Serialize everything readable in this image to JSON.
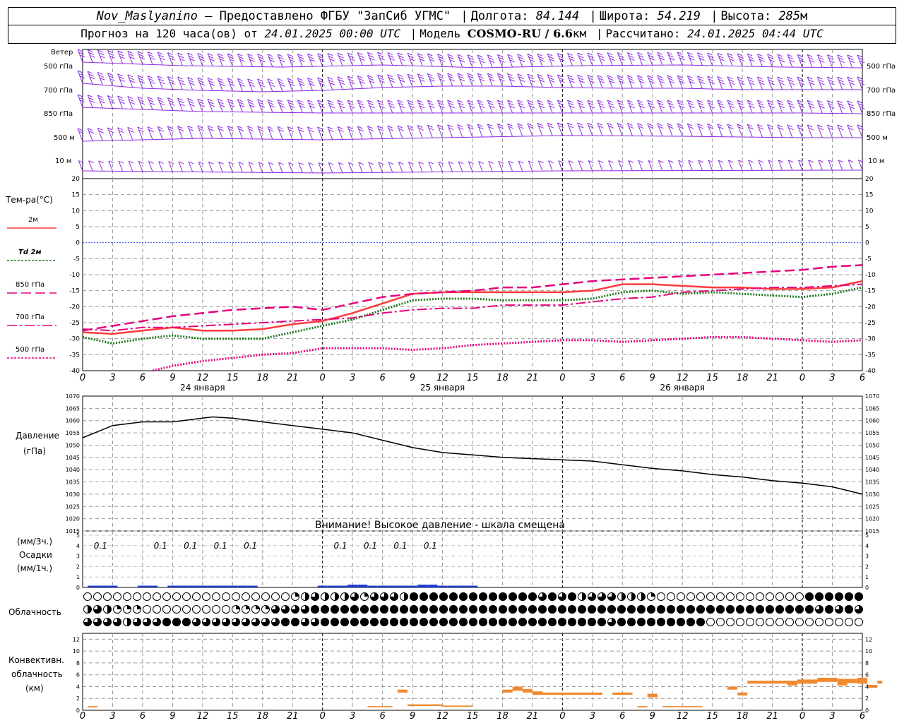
{
  "header": {
    "station": "Nov_Maslyanino",
    "provider": "— Предоставлено ФГБУ \"ЗапСиб УГМС\"",
    "lon_label": "Долгота:",
    "lon": "84.144",
    "lat_label": "Широта:",
    "lat": "54.219",
    "alt_label": "Высота:",
    "alt": "285",
    "alt_unit": "м",
    "forecast_label": "Прогноз на 120 часа(ов) от",
    "forecast_start": "24.01.2025 00:00 UTC",
    "model_label": "Модель",
    "model": "COSMO-RU / 6.6",
    "model_unit": "км",
    "calc_label": "Рассчитано:",
    "calc_time": "24.01.2025 04:44 UTC"
  },
  "wind_panel": {
    "title": "Ветер",
    "levels": [
      "500 гПа",
      "700 гПа",
      "850 гПа",
      "500 м",
      "10 м"
    ],
    "color": "#8a2be2"
  },
  "temp_panel": {
    "title": "Тем-ра(°С)",
    "legend": [
      {
        "label": "2м",
        "color": "#ff3b3b",
        "style": "solid"
      },
      {
        "label": "Td 2м",
        "color": "#1a7a1a",
        "style": "dotted"
      },
      {
        "label": "850 гПа",
        "color": "#e6007e",
        "style": "dashed"
      },
      {
        "label": "700 гПа",
        "color": "#e6007e",
        "style": "dashdot"
      },
      {
        "label": "500 гПа",
        "color": "#e6007e",
        "style": "dotted"
      }
    ],
    "yticks": [
      20,
      15,
      10,
      5,
      0,
      -5,
      -10,
      -15,
      -20,
      -25,
      -30,
      -35,
      -40
    ]
  },
  "time_axis": {
    "hour_labels": [
      "0",
      "3",
      "6",
      "9",
      "12",
      "15",
      "18",
      "21",
      "0",
      "3",
      "6",
      "9",
      "12",
      "15",
      "18",
      "21",
      "0",
      "3",
      "6",
      "9",
      "12",
      "15",
      "18",
      "21",
      "0",
      "3",
      "6"
    ],
    "days": [
      "24 января",
      "25 января",
      "26 января"
    ]
  },
  "pressure_panel": {
    "title_line1": "Давление",
    "title_line2": "(гПа)",
    "warning": "Внимание! Высокое давление - шкала смещена",
    "yticks": [
      1070,
      1065,
      1060,
      1055,
      1050,
      1045,
      1040,
      1035,
      1030,
      1025,
      1020,
      1015
    ]
  },
  "precip_panel": {
    "label_top": "(мм/3ч.)",
    "label_mid": "Осадки",
    "label_bot": "(мм/1ч.)",
    "yticks": [
      "5",
      "4",
      "3",
      "2",
      "1",
      "0"
    ],
    "amount_labels": [
      {
        "hour": 2,
        "text": "0.1"
      },
      {
        "hour": 8,
        "text": "0.1"
      },
      {
        "hour": 11,
        "text": "0.1"
      },
      {
        "hour": 14,
        "text": "0.1"
      },
      {
        "hour": 17,
        "text": "0.1"
      },
      {
        "hour": 26,
        "text": "0.1"
      },
      {
        "hour": 29,
        "text": "0.1"
      },
      {
        "hour": 32,
        "text": "0.1"
      },
      {
        "hour": 35,
        "text": "0.1"
      }
    ]
  },
  "cloud_panel": {
    "title": "Облачность"
  },
  "conv_panel": {
    "title_line1": "Конвективн.",
    "title_line2": "облачность",
    "title_line3": "(км)",
    "yticks": [
      "12",
      "10",
      "8",
      "6",
      "4",
      "2",
      "0"
    ],
    "color": "#f08a30"
  },
  "chart_data": [
    {
      "type": "line",
      "title": "Тем-ра(°С)",
      "x_unit": "hours from 24.01.2025 00:00 UTC",
      "ylim": [
        -40,
        20
      ],
      "series": [
        {
          "name": "2м",
          "x": [
            0,
            3,
            6,
            9,
            12,
            15,
            18,
            21,
            24,
            27,
            30,
            33,
            36,
            39,
            42,
            45,
            48,
            51,
            54,
            57,
            60,
            63,
            66,
            69,
            72,
            75,
            78
          ],
          "y": [
            -28,
            -28.5,
            -27.5,
            -26.5,
            -27.5,
            -27.5,
            -27,
            -25.5,
            -24.5,
            -22,
            -19,
            -16,
            -15.5,
            -15.5,
            -15.5,
            -15.5,
            -15.5,
            -15,
            -13,
            -13,
            -13.5,
            -14,
            -14,
            -14.5,
            -14.5,
            -14,
            -12
          ]
        },
        {
          "name": "Td 2м",
          "x": [
            0,
            3,
            6,
            9,
            12,
            15,
            18,
            21,
            24,
            27,
            30,
            33,
            36,
            39,
            42,
            45,
            48,
            51,
            54,
            57,
            60,
            63,
            66,
            69,
            72,
            75,
            78
          ],
          "y": [
            -29.5,
            -31.5,
            -30,
            -29,
            -30,
            -30,
            -30,
            -28,
            -26,
            -24,
            -21,
            -18,
            -17.5,
            -17.5,
            -18,
            -18,
            -18,
            -17.5,
            -15.5,
            -15,
            -16,
            -15.5,
            -16,
            -16.5,
            -17,
            -16,
            -14
          ]
        },
        {
          "name": "850 гПа",
          "x": [
            0,
            3,
            6,
            9,
            12,
            15,
            18,
            21,
            24,
            27,
            30,
            33,
            36,
            39,
            42,
            45,
            48,
            51,
            54,
            57,
            60,
            63,
            66,
            69,
            72,
            75,
            78
          ],
          "y": [
            -27.5,
            -26,
            -24.5,
            -23,
            -22,
            -21,
            -20.5,
            -20,
            -21,
            -19,
            -17,
            -16,
            -15.5,
            -15,
            -14,
            -14,
            -13,
            -12,
            -11.5,
            -11,
            -10.5,
            -10,
            -9.5,
            -9,
            -8.5,
            -7.5,
            -7
          ]
        },
        {
          "name": "700 гПа",
          "x": [
            0,
            3,
            6,
            9,
            12,
            15,
            18,
            21,
            24,
            27,
            30,
            33,
            36,
            39,
            42,
            45,
            48,
            51,
            54,
            57,
            60,
            63,
            66,
            69,
            72,
            75,
            78
          ],
          "y": [
            -27,
            -27.5,
            -26.5,
            -26.5,
            -26,
            -25.5,
            -25,
            -24.5,
            -24,
            -23.5,
            -22,
            -21,
            -20.5,
            -20.5,
            -19.5,
            -19.5,
            -19.5,
            -18.5,
            -17.5,
            -17,
            -15.5,
            -15,
            -14.5,
            -14,
            -14,
            -13.5,
            -13
          ]
        },
        {
          "name": "500 гПа",
          "x": [
            7,
            9,
            12,
            15,
            18,
            21,
            24,
            27,
            30,
            33,
            36,
            39,
            42,
            45,
            48,
            51,
            54,
            57,
            60,
            63,
            66,
            69,
            72,
            75,
            78
          ],
          "y": [
            -40,
            -38.5,
            -37,
            -36,
            -35,
            -34.5,
            -33,
            -33,
            -33,
            -33.5,
            -33,
            -32,
            -31.5,
            -31,
            -30.5,
            -30.5,
            -31,
            -30.5,
            -30,
            -29.5,
            -29.5,
            -30,
            -30.5,
            -31,
            -30.5
          ]
        }
      ]
    },
    {
      "type": "line",
      "title": "Давление",
      "x_unit": "hours from 24.01.2025 00:00 UTC",
      "ylim": [
        1015,
        1070
      ],
      "series": [
        {
          "name": "Давление",
          "x": [
            0,
            3,
            6,
            9,
            12,
            13,
            15,
            18,
            21,
            24,
            27,
            30,
            33,
            36,
            39,
            42,
            45,
            48,
            51,
            54,
            57,
            60,
            63,
            66,
            69,
            72,
            75,
            78
          ],
          "y": [
            1053,
            1058,
            1059.5,
            1059.5,
            1061,
            1061.5,
            1061,
            1059.5,
            1058,
            1056.5,
            1055,
            1052,
            1049,
            1047,
            1046,
            1045,
            1044.5,
            1044,
            1043.5,
            1042,
            1040.5,
            1039.5,
            1038,
            1037,
            1035.5,
            1034.5,
            1033,
            1030
          ]
        }
      ]
    },
    {
      "type": "bar",
      "title": "Осадки",
      "x_unit": "hours from 24.01.2025 00:00 UTC",
      "ylim": [
        0,
        5
      ],
      "x": [
        1,
        2,
        3,
        6,
        7,
        9,
        10,
        11,
        12,
        13,
        14,
        15,
        16,
        17,
        24,
        25,
        26,
        27,
        28,
        29,
        30,
        31,
        32,
        33,
        34,
        35,
        36,
        37,
        38,
        39
      ],
      "values": [
        0.1,
        0.1,
        0.1,
        0.1,
        0.1,
        0.1,
        0.1,
        0.1,
        0.1,
        0.1,
        0.1,
        0.1,
        0.1,
        0.1,
        0.1,
        0.1,
        0.1,
        0.2,
        0.2,
        0.1,
        0.1,
        0.1,
        0.1,
        0.1,
        0.2,
        0.2,
        0.1,
        0.1,
        0.1,
        0.1
      ]
    },
    {
      "type": "bar",
      "title": "Конвективн. облачность (км)",
      "x_unit": "hours from 24.01.2025 00:00 UTC",
      "ylim": [
        0,
        13
      ],
      "segments": [
        {
          "x0": 0.5,
          "x1": 1.5,
          "bottom": 0.5,
          "top": 0.7
        },
        {
          "x0": 28.5,
          "x1": 31,
          "bottom": 0.6,
          "top": 0.7
        },
        {
          "x0": 31.5,
          "x1": 32.5,
          "bottom": 3,
          "top": 3.5
        },
        {
          "x0": 32.5,
          "x1": 36,
          "bottom": 0.7,
          "top": 1
        },
        {
          "x0": 36,
          "x1": 39,
          "bottom": 0.6,
          "top": 0.8
        },
        {
          "x0": 42,
          "x1": 43,
          "bottom": 3,
          "top": 3.5
        },
        {
          "x0": 43,
          "x1": 44,
          "bottom": 3.3,
          "top": 4
        },
        {
          "x0": 44,
          "x1": 45,
          "bottom": 3,
          "top": 3.6
        },
        {
          "x0": 45,
          "x1": 46,
          "bottom": 2.6,
          "top": 3.2
        },
        {
          "x0": 46,
          "x1": 50,
          "bottom": 2.6,
          "top": 3
        },
        {
          "x0": 50,
          "x1": 51,
          "bottom": 2.6,
          "top": 3
        },
        {
          "x0": 51,
          "x1": 52,
          "bottom": 2.6,
          "top": 3
        },
        {
          "x0": 53,
          "x1": 55,
          "bottom": 2.6,
          "top": 3
        },
        {
          "x0": 55.5,
          "x1": 56.5,
          "bottom": 0.5,
          "top": 0.7
        },
        {
          "x0": 56.5,
          "x1": 57.5,
          "bottom": 2.2,
          "top": 2.8
        },
        {
          "x0": 58,
          "x1": 62,
          "bottom": 0.6,
          "top": 0.7
        },
        {
          "x0": 64.5,
          "x1": 65.5,
          "bottom": 3.5,
          "top": 4
        },
        {
          "x0": 65.5,
          "x1": 66.5,
          "bottom": 2.5,
          "top": 3
        },
        {
          "x0": 66.5,
          "x1": 70.5,
          "bottom": 4.5,
          "top": 5
        },
        {
          "x0": 70.5,
          "x1": 71.5,
          "bottom": 4.2,
          "top": 5
        },
        {
          "x0": 71.5,
          "x1": 73.5,
          "bottom": 4.5,
          "top": 5.2
        },
        {
          "x0": 73.5,
          "x1": 75.5,
          "bottom": 4.8,
          "top": 5.5
        },
        {
          "x0": 75.5,
          "x1": 76.5,
          "bottom": 4.2,
          "top": 5.3
        },
        {
          "x0": 76.5,
          "x1": 77.5,
          "bottom": 4.6,
          "top": 5.3
        },
        {
          "x0": 77.5,
          "x1": 78.5,
          "bottom": 4.5,
          "top": 5.5
        },
        {
          "x0": 78.5,
          "x1": 79.5,
          "bottom": 3.8,
          "top": 4.3
        },
        {
          "x0": 79.5,
          "x1": 80,
          "bottom": 4.5,
          "top": 5
        }
      ]
    }
  ],
  "cloud_rows": {
    "description_only_in_script": true
  }
}
